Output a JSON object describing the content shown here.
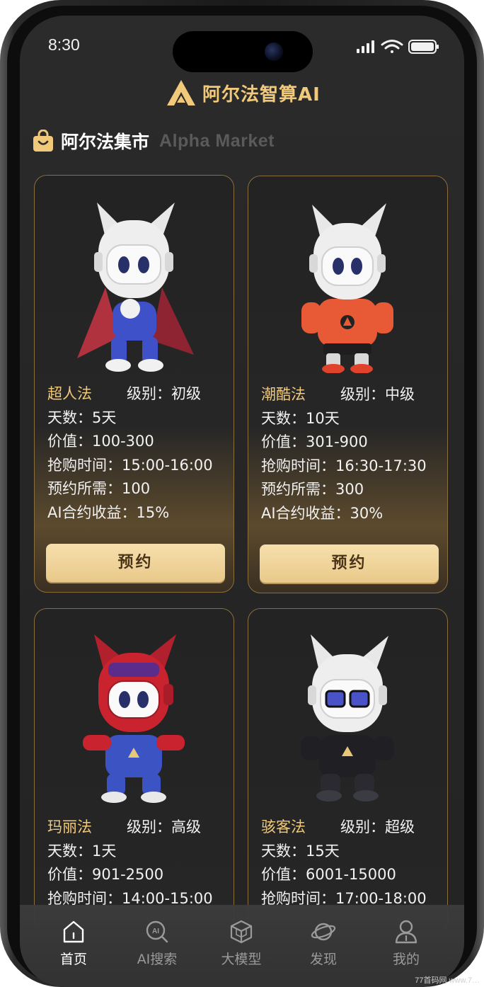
{
  "status": {
    "time": "8:30"
  },
  "header": {
    "brand": "阿尔法智算AI"
  },
  "market": {
    "title": "阿尔法集市",
    "subtitle": "Alpha Market"
  },
  "cards": [
    {
      "name": "超人法",
      "level": "级别：初级",
      "days": "天数：5天",
      "value": "价值：100-300",
      "time": "抢购时间：15:00-16:00",
      "deposit": "预约所需：100",
      "yield": "AI合约收益：15%",
      "button": "预约",
      "character": "superhero-robot-figure"
    },
    {
      "name": "潮酷法",
      "level": "级别：中级",
      "days": "天数：10天",
      "value": "价值：301-900",
      "time": "抢购时间：16:30-17:30",
      "deposit": "预约所需：300",
      "yield": "AI合约收益：30%",
      "button": "预约",
      "character": "hoodie-robot-figure"
    },
    {
      "name": "玛丽法",
      "level": "级别：高级",
      "days": "天数：1天",
      "value": "价值：901-2500",
      "time": "抢购时间：14:00-15:00",
      "character": "plumber-robot-figure"
    },
    {
      "name": "骇客法",
      "level": "级别：超级",
      "days": "天数：15天",
      "value": "价值：6001-15000",
      "time": "抢购时间：17:00-18:00",
      "character": "hacker-robot-figure"
    }
  ],
  "tabs": [
    {
      "label": "首页",
      "icon": "home-icon",
      "active": true
    },
    {
      "label": "AI搜索",
      "icon": "ai-search-icon",
      "active": false
    },
    {
      "label": "大模型",
      "icon": "cube-icon",
      "active": false
    },
    {
      "label": "发现",
      "icon": "planet-icon",
      "active": false
    },
    {
      "label": "我的",
      "icon": "user-icon",
      "active": false
    }
  ],
  "watermark": "77首码网 www.7…"
}
